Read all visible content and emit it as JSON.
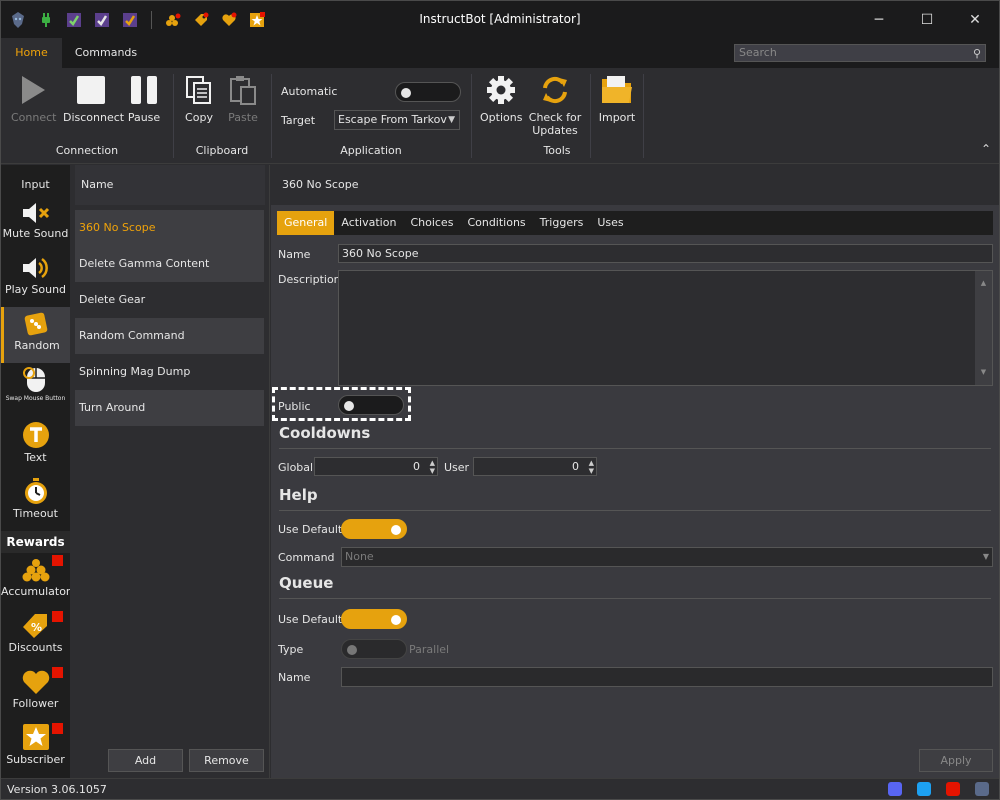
{
  "window": {
    "title": "InstructBot [Administrator]",
    "minimize": "─",
    "maximize": "☐",
    "close": "✕"
  },
  "ribbon_tabs": [
    "Home",
    "Commands"
  ],
  "search": {
    "placeholder": "Search"
  },
  "ribbon": {
    "connect": "Connect",
    "disconnect": "Disconnect",
    "pause": "Pause",
    "connection_group": "Connection",
    "copy": "Copy",
    "paste": "Paste",
    "clipboard_group": "Clipboard",
    "automatic_label": "Automatic",
    "target_label": "Target",
    "target_value": "Escape From Tarkov",
    "application_group": "Application",
    "options": "Options",
    "check_updates_1": "Check for",
    "check_updates_2": "Updates",
    "tools_group": "Tools",
    "import": "Import"
  },
  "nav": {
    "items": [
      "Input",
      "Mute Sound",
      "Play Sound",
      "Random",
      "Swap Mouse Button",
      "Text",
      "Timeout"
    ],
    "rewards_header": "Rewards",
    "rewards": [
      "Accumulator",
      "Discounts",
      "Follower",
      "Subscriber"
    ]
  },
  "list": {
    "header": "Name",
    "commands": [
      "360 No Scope",
      "Delete Gamma Content",
      "Delete Gear",
      "Random Command",
      "Spinning Mag Dump",
      "Turn Around"
    ],
    "add": "Add",
    "remove": "Remove"
  },
  "detail": {
    "title": "360 No Scope",
    "tabs": [
      "General",
      "Activation",
      "Choices",
      "Conditions",
      "Triggers",
      "Uses"
    ],
    "name_label": "Name",
    "name_value": "360 No Scope",
    "description_label": "Description",
    "public_label": "Public",
    "cooldowns": "Cooldowns",
    "global_label": "Global",
    "global_value": "0",
    "user_label": "User",
    "user_value": "0",
    "help": "Help",
    "use_default": "Use Default",
    "command_label": "Command",
    "command_value": "None",
    "queue": "Queue",
    "type_label": "Type",
    "type_value": "Parallel",
    "queue_name_label": "Name",
    "apply": "Apply"
  },
  "status": {
    "version": "Version 3.06.1057"
  },
  "colors": {
    "accent": "#e6a20e",
    "background": "#2d2d30",
    "reward_badge": "#e51400"
  }
}
